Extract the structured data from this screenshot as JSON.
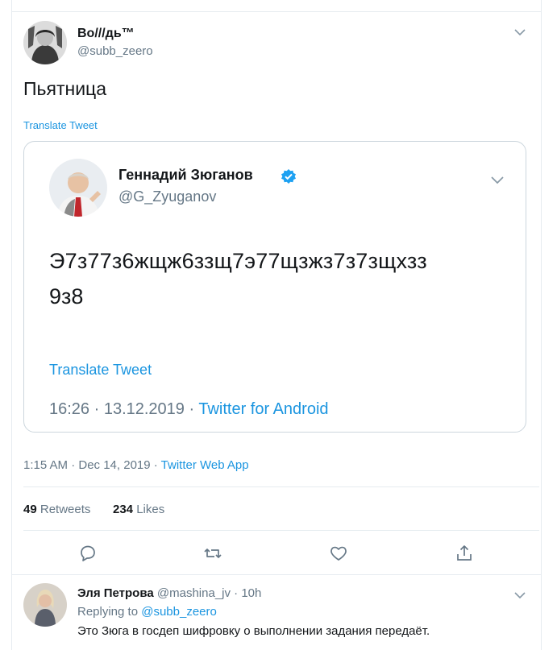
{
  "tweet": {
    "author_name": "Во///дь™",
    "author_handle": "@subb_zeero",
    "text": "Пьятница",
    "translate_label": "Translate Tweet",
    "timestamp": "1:15 AM · Dec 14, 2019",
    "separator": " · ",
    "source": "Twitter Web App",
    "retweets_count": "49",
    "retweets_label": "Retweets",
    "likes_count": "234",
    "likes_label": "Likes"
  },
  "quoted": {
    "author_name": "Геннадий Зюганов",
    "author_handle": "@G_Zyuganov",
    "text_line1": "Э7з77з6жщж6ззщ7э77щзжз7з7зщхзз",
    "text_line2": "9з8",
    "translate_label": "Translate Tweet",
    "timestamp": "16:26 · 13.12.2019 · ",
    "source": "Twitter for Android",
    "verified": true
  },
  "reply": {
    "author_name": "Эля Петрова",
    "author_handle": "@mashina_jv",
    "time": " · 10h",
    "replying_prefix": "Replying to ",
    "replying_handle": "@subb_zeero",
    "text": "Это Зюга в госдеп шифровку о выполнении задания передаёт."
  },
  "icons": {
    "reply": "reply-icon",
    "retweet": "retweet-icon",
    "like": "heart-icon",
    "share": "share-icon",
    "menu": "chevron-down-icon",
    "verified": "verified-badge-icon"
  },
  "colors": {
    "link": "#1b95e0",
    "verified": "#1da1f2",
    "muted": "#657786",
    "border": "#e6ecf0"
  }
}
